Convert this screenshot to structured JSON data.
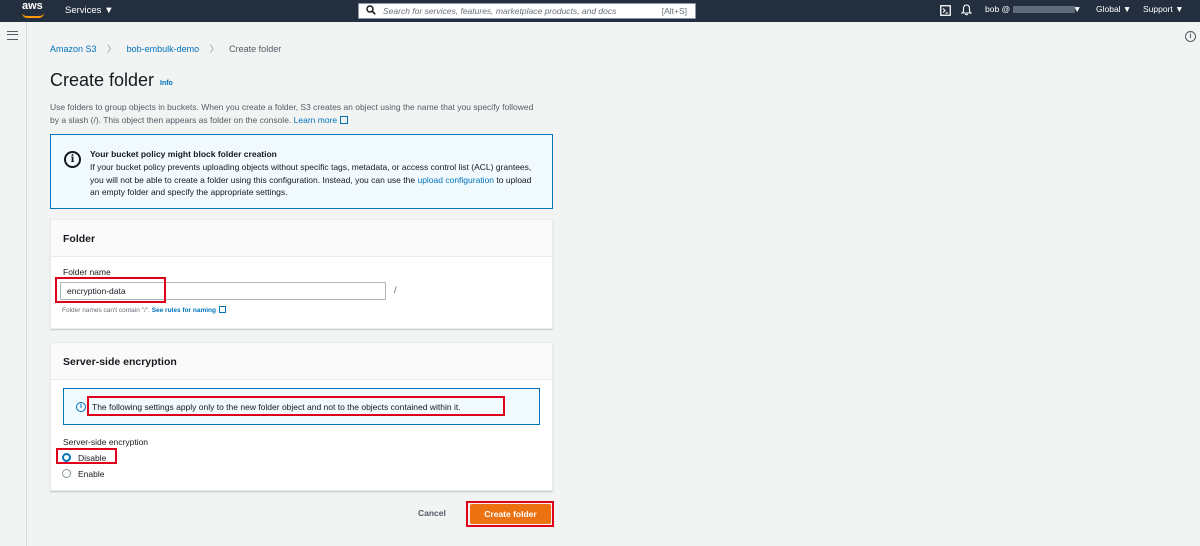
{
  "nav": {
    "logo": "aws",
    "services": "Services ▼",
    "search_placeholder": "Search for services, features, marketplace products, and docs",
    "search_shortcut": "[Alt+S]",
    "user": "bob @",
    "region": "Global ▼",
    "support": "Support ▼"
  },
  "breadcrumb": {
    "items": [
      "Amazon S3",
      "bob-embulk-demo"
    ],
    "current": "Create folder"
  },
  "page": {
    "title": "Create folder",
    "info_link": "Info",
    "description": "Use folders to group objects in buckets. When you create a folder, S3 creates an object using the name that you specify followed by a slash (/). This object then appears as folder on the console.",
    "learn_more": "Learn more"
  },
  "alert": {
    "title": "Your bucket policy might block folder creation",
    "body_pre": "If your bucket policy prevents uploading objects without specific tags, metadata, or access control list (ACL) grantees, you will not be able to create a folder using this configuration. Instead, you can use the",
    "link": "upload configuration",
    "body_post": "to upload an empty folder and specify the appropriate settings."
  },
  "folder_panel": {
    "heading": "Folder",
    "field_label": "Folder name",
    "field_value": "encryption-data",
    "suffix": "/",
    "hint_pre": "Folder names can't contain \"/\".",
    "hint_link": "See rules for naming"
  },
  "sse_panel": {
    "heading": "Server-side encryption",
    "info": "The following settings apply only to the new folder object and not to the objects contained within it.",
    "field_label": "Server-side encryption",
    "options": [
      "Disable",
      "Enable"
    ],
    "selected": "Disable"
  },
  "actions": {
    "cancel": "Cancel",
    "create": "Create folder"
  },
  "colors": {
    "nav_bg": "#232f3e",
    "link": "#0073bb",
    "primary_button": "#ec7211",
    "highlight": "#e0001b"
  }
}
